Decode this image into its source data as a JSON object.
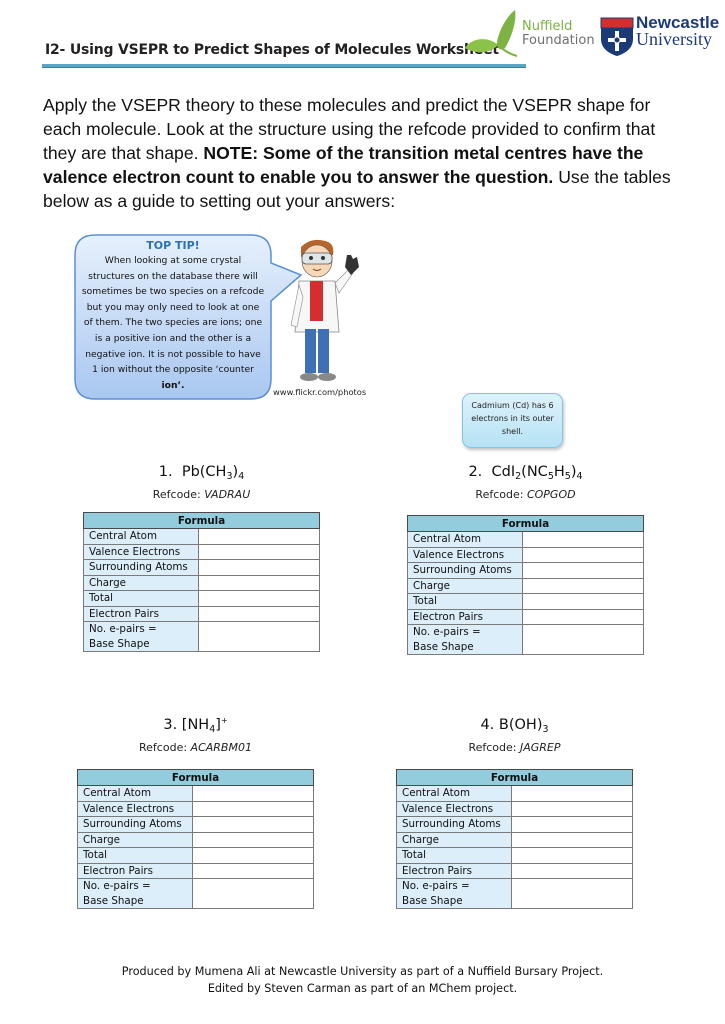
{
  "header": {
    "title": "I2- Using VSEPR to Predict Shapes of Molecules Worksheet",
    "logos": {
      "nuffield": {
        "line1": "Nuffield",
        "line2": "Foundation"
      },
      "newcastle": {
        "line1": "Newcastle",
        "line2": "University"
      }
    },
    "colors": {
      "rule": "#5aa5c6",
      "nuffield_green": "#7cb342",
      "newcastle_blue": "#1d3a78"
    }
  },
  "intro": {
    "part1": "Apply the VSEPR theory to these molecules and predict the VSEPR shape for each molecule. Look at the structure using the refcode provided to confirm that they are that shape. ",
    "bold": "NOTE: Some of the transition metal centres have the valence electron count to enable you to answer the question.",
    "part2": " Use the tables below as a guide to setting out your answers:"
  },
  "tip": {
    "title": "TOP TIP!",
    "body": "When looking at some crystal structures on the database there will sometimes be two species on a refcode but you may only need to look at one of them. The two species are ions; one is a positive ion and the other is a negative ion. It is not possible to have 1 ion without the opposite ‘counter ",
    "body_bold": "ion’.",
    "image_icon": "scientist-cartoon",
    "credit": "www.flickr.com/photos"
  },
  "cd_note": {
    "text": "Cadmium (Cd) has 6 electrons in its outer shell."
  },
  "molecules": [
    {
      "number": "1.",
      "formula_parts": [
        "Pb(CH",
        "3",
        ")",
        "4"
      ],
      "refcode_label": "Refcode: ",
      "refcode": "VADRAU"
    },
    {
      "number": "2.",
      "formula_parts": [
        "CdI",
        "2",
        "(NC",
        "5",
        "H",
        "5",
        ")",
        "4"
      ],
      "refcode_label": "Refcode: ",
      "refcode": "COPGOD"
    },
    {
      "number": "3.",
      "formula_parts": [
        "[NH",
        "4",
        "]",
        "+"
      ],
      "refcode_label": "Refcode: ",
      "refcode": "ACARBM01"
    },
    {
      "number": "4.",
      "formula_parts": [
        "B(OH)",
        "3"
      ],
      "refcode_label": "Refcode: ",
      "refcode": "JAGREP"
    }
  ],
  "table": {
    "header": "Formula",
    "rows": [
      "Central Atom",
      "Valence Electrons",
      "Surrounding Atoms",
      "Charge",
      "Total",
      "Electron Pairs"
    ],
    "last_row_line1": "No. e-pairs =",
    "last_row_line2": "Base Shape",
    "colors": {
      "header_bg": "#93cddd",
      "label_bg": "#dbeef9"
    }
  },
  "footer": {
    "line1": "Produced by Mumena Ali at Newcastle University as part of a Nuffield Bursary Project.",
    "line2": "Edited by Steven Carman as part of an MChem project."
  }
}
